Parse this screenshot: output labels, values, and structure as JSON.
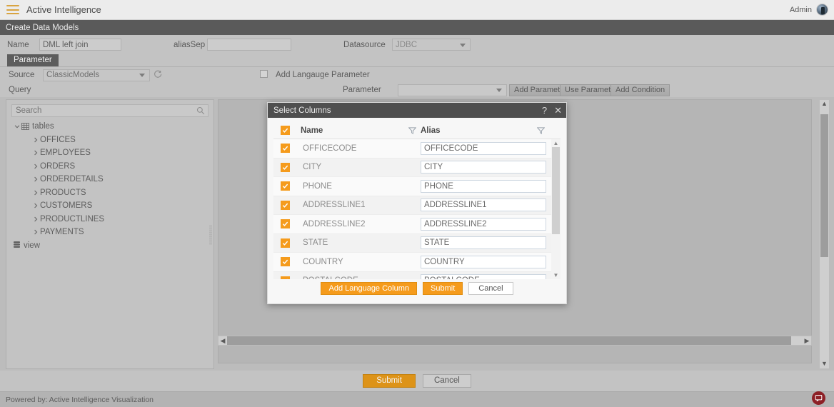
{
  "topbar": {
    "menu_icon": "hamburger-icon",
    "app_title": "Active Intelligence",
    "user_label": "Admin"
  },
  "page": {
    "title": "Create Data Models"
  },
  "form": {
    "name_label": "Name",
    "name_value": "DML left join",
    "aliassep_label": "aliasSep",
    "aliassep_value": "",
    "datasource_label": "Datasource",
    "datasource_value": "JDBC",
    "tab_label": "Parameter",
    "source_label": "Source",
    "source_value": "ClassicModels",
    "refresh_icon": "refresh-icon",
    "query_label": "Query",
    "add_language_parameter_label": "Add Langauge Parameter",
    "add_language_parameter_checked": false,
    "parameter_label": "Parameter",
    "parameter_value": "",
    "add_parameter_label": "Add Parameter",
    "use_parameter_label": "Use Parameter",
    "add_condition_label": "Add Condition"
  },
  "tree_panel": {
    "search_placeholder": "Search",
    "search_value": "",
    "search_icon": "search-icon",
    "root_label": "tables",
    "root_icon": "grid-icon",
    "tables": [
      "OFFICES",
      "EMPLOYEES",
      "ORDERS",
      "ORDERDETAILS",
      "PRODUCTS",
      "CUSTOMERS",
      "PRODUCTLINES",
      "PAYMENTS"
    ],
    "view_label": "view",
    "view_icon": "database-icon"
  },
  "modal": {
    "title": "Select Columns",
    "help_icon": "question-mark-icon",
    "close_icon": "close-icon",
    "header_checkbox_checked": true,
    "columns": {
      "name": "Name",
      "alias": "Alias",
      "filter_icon": "filter-icon"
    },
    "rows": [
      {
        "checked": true,
        "name": "OFFICECODE",
        "alias": "OFFICECODE"
      },
      {
        "checked": true,
        "name": "CITY",
        "alias": "CITY"
      },
      {
        "checked": true,
        "name": "PHONE",
        "alias": "PHONE"
      },
      {
        "checked": true,
        "name": "ADDRESSLINE1",
        "alias": "ADDRESSLINE1"
      },
      {
        "checked": true,
        "name": "ADDRESSLINE2",
        "alias": "ADDRESSLINE2"
      },
      {
        "checked": true,
        "name": "STATE",
        "alias": "STATE"
      },
      {
        "checked": true,
        "name": "COUNTRY",
        "alias": "COUNTRY"
      },
      {
        "checked": true,
        "name": "POSTALCODE",
        "alias": "POSTALCODE"
      }
    ],
    "buttons": {
      "add_language_column": "Add Language Column",
      "submit": "Submit",
      "cancel": "Cancel"
    }
  },
  "actions": {
    "submit_label": "Submit",
    "cancel_label": "Cancel"
  },
  "footer": {
    "text": "Powered by: Active Intelligence Visualization",
    "chat_icon": "chat-bubble-icon"
  },
  "colors": {
    "accent_orange": "#f59b1c",
    "button_orange": "#dd9318",
    "header_dark": "#4f4f4f",
    "page_strip": "#5a5a5a",
    "chat_fab": "#8d2026"
  }
}
